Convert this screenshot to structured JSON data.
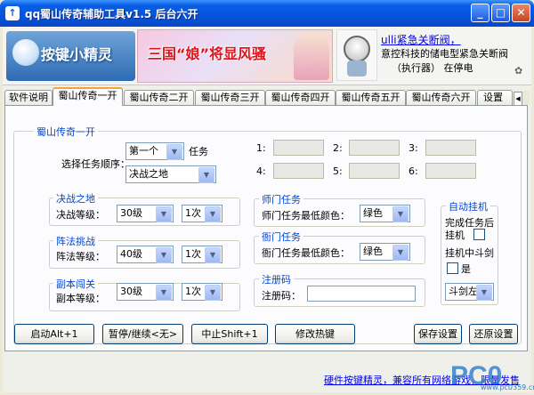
{
  "window": {
    "title": "qq蜀山传奇辅助工具v1.5 后台六开",
    "icon": "app-logo-icon"
  },
  "banner": {
    "logo_text": "按键小精灵",
    "ad_text": "三国“娘”将显风骚",
    "news_link": "ulli紧急关断阀，",
    "news_line2": "意控科技的储电型紧急关断阀",
    "news_line3": "（执行器）    在停电"
  },
  "tabs": [
    "软件说明",
    "蜀山传奇一开",
    "蜀山传奇二开",
    "蜀山传奇三开",
    "蜀山传奇四开",
    "蜀山传奇五开",
    "蜀山传奇六开",
    "设置"
  ],
  "active_tab": 1,
  "main": {
    "group_title": "蜀山传奇一开",
    "order_label": "选择任务顺序：",
    "order_value": "第一个",
    "task_label": "任务",
    "task_value": "决战之地",
    "slots": [
      "1:",
      "2:",
      "3:",
      "4:",
      "5:",
      "6:"
    ]
  },
  "juezhan": {
    "title": "决战之地",
    "label": "决战等级：",
    "level": "30级",
    "times": "1次"
  },
  "zhenfa": {
    "title": "阵法挑战",
    "label": "阵法等级：",
    "level": "40级",
    "times": "1次"
  },
  "fuben": {
    "title": "副本闯关",
    "label": "副本等级：",
    "level": "30级",
    "times": "1次"
  },
  "shimen": {
    "title": "师门任务",
    "label": "师门任务最低颜色：",
    "color": "绿色"
  },
  "yamen": {
    "title": "衙门任务",
    "label": "衙门任务最低颜色：",
    "color": "绿色"
  },
  "register": {
    "title": "注册码",
    "label": "注册码：",
    "value": ""
  },
  "auto": {
    "title": "自动挂机",
    "label1": "完成任务后",
    "label2": "挂机",
    "label3": "挂机中斗剑",
    "label4": "是",
    "select": "斗剑左"
  },
  "buttons": {
    "start": "启动Alt+1",
    "pause": "暂停/继续<无>",
    "stop": "中止Shift+1",
    "hotkey": "修改热键",
    "save": "保存设置",
    "restore": "还原设置"
  },
  "status": {
    "link": "硬件按键精灵，兼容所有网络游戏，限量发售"
  },
  "watermark": {
    "text": "PC0",
    "sub": "www.pc0359.cn"
  },
  "colors": {
    "title_bar": "#0A5FE7",
    "group_title": "#0046D5",
    "active_tab_border": "#F1A43B"
  }
}
